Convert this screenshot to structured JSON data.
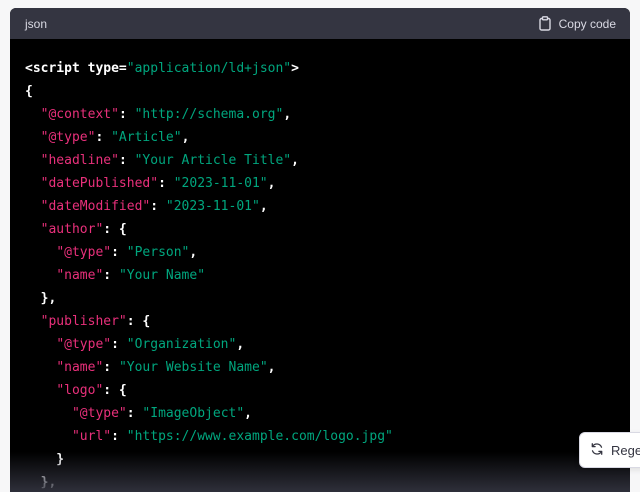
{
  "header": {
    "language": "json",
    "copy_label": "Copy code",
    "copy_icon": "clipboard-icon"
  },
  "code_lines": [
    [
      {
        "t": "tag",
        "v": "<script "
      },
      {
        "t": "attr",
        "v": "type="
      },
      {
        "t": "str",
        "v": "\"application/ld+json\""
      },
      {
        "t": "tag",
        "v": ">"
      }
    ],
    [
      {
        "t": "punc",
        "v": "{"
      }
    ],
    [
      {
        "t": "punc",
        "v": "  "
      },
      {
        "t": "key",
        "v": "\"@context\""
      },
      {
        "t": "punc",
        "v": ": "
      },
      {
        "t": "str",
        "v": "\"http://schema.org\""
      },
      {
        "t": "punc",
        "v": ","
      }
    ],
    [
      {
        "t": "punc",
        "v": "  "
      },
      {
        "t": "key",
        "v": "\"@type\""
      },
      {
        "t": "punc",
        "v": ": "
      },
      {
        "t": "str",
        "v": "\"Article\""
      },
      {
        "t": "punc",
        "v": ","
      }
    ],
    [
      {
        "t": "punc",
        "v": "  "
      },
      {
        "t": "key",
        "v": "\"headline\""
      },
      {
        "t": "punc",
        "v": ": "
      },
      {
        "t": "str",
        "v": "\"Your Article Title\""
      },
      {
        "t": "punc",
        "v": ","
      }
    ],
    [
      {
        "t": "punc",
        "v": "  "
      },
      {
        "t": "key",
        "v": "\"datePublished\""
      },
      {
        "t": "punc",
        "v": ": "
      },
      {
        "t": "str",
        "v": "\"2023-11-01\""
      },
      {
        "t": "punc",
        "v": ","
      }
    ],
    [
      {
        "t": "punc",
        "v": "  "
      },
      {
        "t": "key",
        "v": "\"dateModified\""
      },
      {
        "t": "punc",
        "v": ": "
      },
      {
        "t": "str",
        "v": "\"2023-11-01\""
      },
      {
        "t": "punc",
        "v": ","
      }
    ],
    [
      {
        "t": "punc",
        "v": "  "
      },
      {
        "t": "key",
        "v": "\"author\""
      },
      {
        "t": "punc",
        "v": ": {"
      }
    ],
    [
      {
        "t": "punc",
        "v": "    "
      },
      {
        "t": "key",
        "v": "\"@type\""
      },
      {
        "t": "punc",
        "v": ": "
      },
      {
        "t": "str",
        "v": "\"Person\""
      },
      {
        "t": "punc",
        "v": ","
      }
    ],
    [
      {
        "t": "punc",
        "v": "    "
      },
      {
        "t": "key",
        "v": "\"name\""
      },
      {
        "t": "punc",
        "v": ": "
      },
      {
        "t": "str",
        "v": "\"Your Name\""
      }
    ],
    [
      {
        "t": "punc",
        "v": "  },"
      }
    ],
    [
      {
        "t": "punc",
        "v": "  "
      },
      {
        "t": "key",
        "v": "\"publisher\""
      },
      {
        "t": "punc",
        "v": ": {"
      }
    ],
    [
      {
        "t": "punc",
        "v": "    "
      },
      {
        "t": "key",
        "v": "\"@type\""
      },
      {
        "t": "punc",
        "v": ": "
      },
      {
        "t": "str",
        "v": "\"Organization\""
      },
      {
        "t": "punc",
        "v": ","
      }
    ],
    [
      {
        "t": "punc",
        "v": "    "
      },
      {
        "t": "key",
        "v": "\"name\""
      },
      {
        "t": "punc",
        "v": ": "
      },
      {
        "t": "str",
        "v": "\"Your Website Name\""
      },
      {
        "t": "punc",
        "v": ","
      }
    ],
    [
      {
        "t": "punc",
        "v": "    "
      },
      {
        "t": "key",
        "v": "\"logo\""
      },
      {
        "t": "punc",
        "v": ": {"
      }
    ],
    [
      {
        "t": "punc",
        "v": "      "
      },
      {
        "t": "key",
        "v": "\"@type\""
      },
      {
        "t": "punc",
        "v": ": "
      },
      {
        "t": "str",
        "v": "\"ImageObject\""
      },
      {
        "t": "punc",
        "v": ","
      }
    ],
    [
      {
        "t": "punc",
        "v": "      "
      },
      {
        "t": "key",
        "v": "\"url\""
      },
      {
        "t": "punc",
        "v": ": "
      },
      {
        "t": "str",
        "v": "\"https://www.example.com/logo.jpg\""
      }
    ],
    [
      {
        "t": "punc",
        "v": "    }"
      }
    ],
    [
      {
        "t": "punc",
        "v": "  },"
      }
    ]
  ],
  "regenerate": {
    "label": "Rege",
    "icon": "refresh-icon"
  },
  "colors": {
    "header_bg": "#343541",
    "code_bg": "#000000",
    "key": "#e9307b",
    "string": "#00a67e",
    "plain": "#ffffff"
  }
}
